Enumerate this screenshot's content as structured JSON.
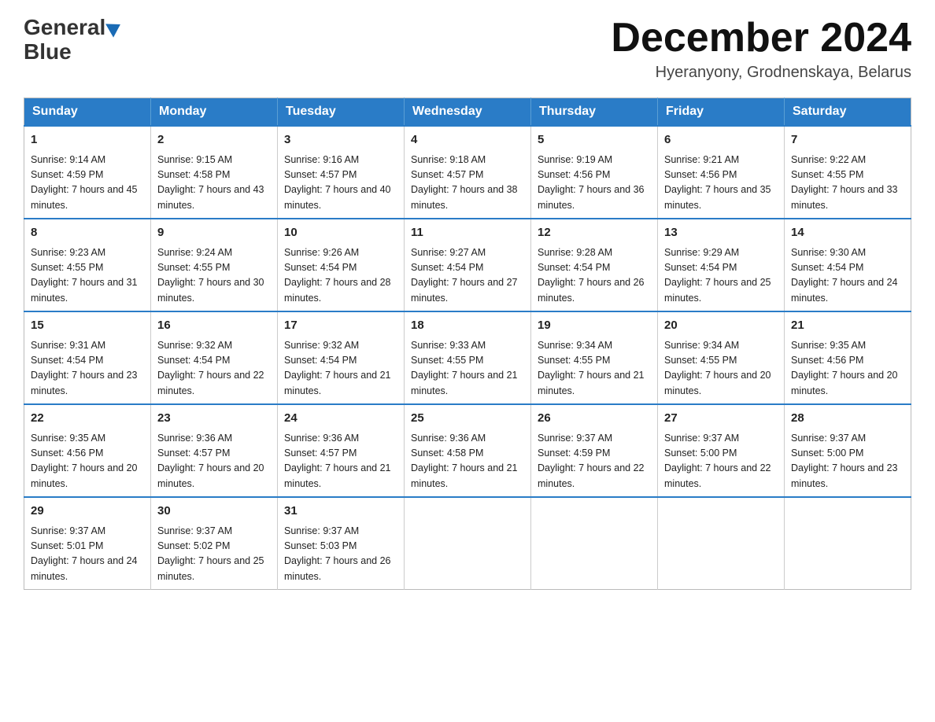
{
  "header": {
    "logo_line1": "General",
    "logo_line2": "Blue",
    "month_title": "December 2024",
    "location": "Hyeranyony, Grodnenskaya, Belarus"
  },
  "days_of_week": [
    "Sunday",
    "Monday",
    "Tuesday",
    "Wednesday",
    "Thursday",
    "Friday",
    "Saturday"
  ],
  "weeks": [
    [
      {
        "day": "1",
        "sunrise": "9:14 AM",
        "sunset": "4:59 PM",
        "daylight": "7 hours and 45 minutes."
      },
      {
        "day": "2",
        "sunrise": "9:15 AM",
        "sunset": "4:58 PM",
        "daylight": "7 hours and 43 minutes."
      },
      {
        "day": "3",
        "sunrise": "9:16 AM",
        "sunset": "4:57 PM",
        "daylight": "7 hours and 40 minutes."
      },
      {
        "day": "4",
        "sunrise": "9:18 AM",
        "sunset": "4:57 PM",
        "daylight": "7 hours and 38 minutes."
      },
      {
        "day": "5",
        "sunrise": "9:19 AM",
        "sunset": "4:56 PM",
        "daylight": "7 hours and 36 minutes."
      },
      {
        "day": "6",
        "sunrise": "9:21 AM",
        "sunset": "4:56 PM",
        "daylight": "7 hours and 35 minutes."
      },
      {
        "day": "7",
        "sunrise": "9:22 AM",
        "sunset": "4:55 PM",
        "daylight": "7 hours and 33 minutes."
      }
    ],
    [
      {
        "day": "8",
        "sunrise": "9:23 AM",
        "sunset": "4:55 PM",
        "daylight": "7 hours and 31 minutes."
      },
      {
        "day": "9",
        "sunrise": "9:24 AM",
        "sunset": "4:55 PM",
        "daylight": "7 hours and 30 minutes."
      },
      {
        "day": "10",
        "sunrise": "9:26 AM",
        "sunset": "4:54 PM",
        "daylight": "7 hours and 28 minutes."
      },
      {
        "day": "11",
        "sunrise": "9:27 AM",
        "sunset": "4:54 PM",
        "daylight": "7 hours and 27 minutes."
      },
      {
        "day": "12",
        "sunrise": "9:28 AM",
        "sunset": "4:54 PM",
        "daylight": "7 hours and 26 minutes."
      },
      {
        "day": "13",
        "sunrise": "9:29 AM",
        "sunset": "4:54 PM",
        "daylight": "7 hours and 25 minutes."
      },
      {
        "day": "14",
        "sunrise": "9:30 AM",
        "sunset": "4:54 PM",
        "daylight": "7 hours and 24 minutes."
      }
    ],
    [
      {
        "day": "15",
        "sunrise": "9:31 AM",
        "sunset": "4:54 PM",
        "daylight": "7 hours and 23 minutes."
      },
      {
        "day": "16",
        "sunrise": "9:32 AM",
        "sunset": "4:54 PM",
        "daylight": "7 hours and 22 minutes."
      },
      {
        "day": "17",
        "sunrise": "9:32 AM",
        "sunset": "4:54 PM",
        "daylight": "7 hours and 21 minutes."
      },
      {
        "day": "18",
        "sunrise": "9:33 AM",
        "sunset": "4:55 PM",
        "daylight": "7 hours and 21 minutes."
      },
      {
        "day": "19",
        "sunrise": "9:34 AM",
        "sunset": "4:55 PM",
        "daylight": "7 hours and 21 minutes."
      },
      {
        "day": "20",
        "sunrise": "9:34 AM",
        "sunset": "4:55 PM",
        "daylight": "7 hours and 20 minutes."
      },
      {
        "day": "21",
        "sunrise": "9:35 AM",
        "sunset": "4:56 PM",
        "daylight": "7 hours and 20 minutes."
      }
    ],
    [
      {
        "day": "22",
        "sunrise": "9:35 AM",
        "sunset": "4:56 PM",
        "daylight": "7 hours and 20 minutes."
      },
      {
        "day": "23",
        "sunrise": "9:36 AM",
        "sunset": "4:57 PM",
        "daylight": "7 hours and 20 minutes."
      },
      {
        "day": "24",
        "sunrise": "9:36 AM",
        "sunset": "4:57 PM",
        "daylight": "7 hours and 21 minutes."
      },
      {
        "day": "25",
        "sunrise": "9:36 AM",
        "sunset": "4:58 PM",
        "daylight": "7 hours and 21 minutes."
      },
      {
        "day": "26",
        "sunrise": "9:37 AM",
        "sunset": "4:59 PM",
        "daylight": "7 hours and 22 minutes."
      },
      {
        "day": "27",
        "sunrise": "9:37 AM",
        "sunset": "5:00 PM",
        "daylight": "7 hours and 22 minutes."
      },
      {
        "day": "28",
        "sunrise": "9:37 AM",
        "sunset": "5:00 PM",
        "daylight": "7 hours and 23 minutes."
      }
    ],
    [
      {
        "day": "29",
        "sunrise": "9:37 AM",
        "sunset": "5:01 PM",
        "daylight": "7 hours and 24 minutes."
      },
      {
        "day": "30",
        "sunrise": "9:37 AM",
        "sunset": "5:02 PM",
        "daylight": "7 hours and 25 minutes."
      },
      {
        "day": "31",
        "sunrise": "9:37 AM",
        "sunset": "5:03 PM",
        "daylight": "7 hours and 26 minutes."
      },
      null,
      null,
      null,
      null
    ]
  ]
}
